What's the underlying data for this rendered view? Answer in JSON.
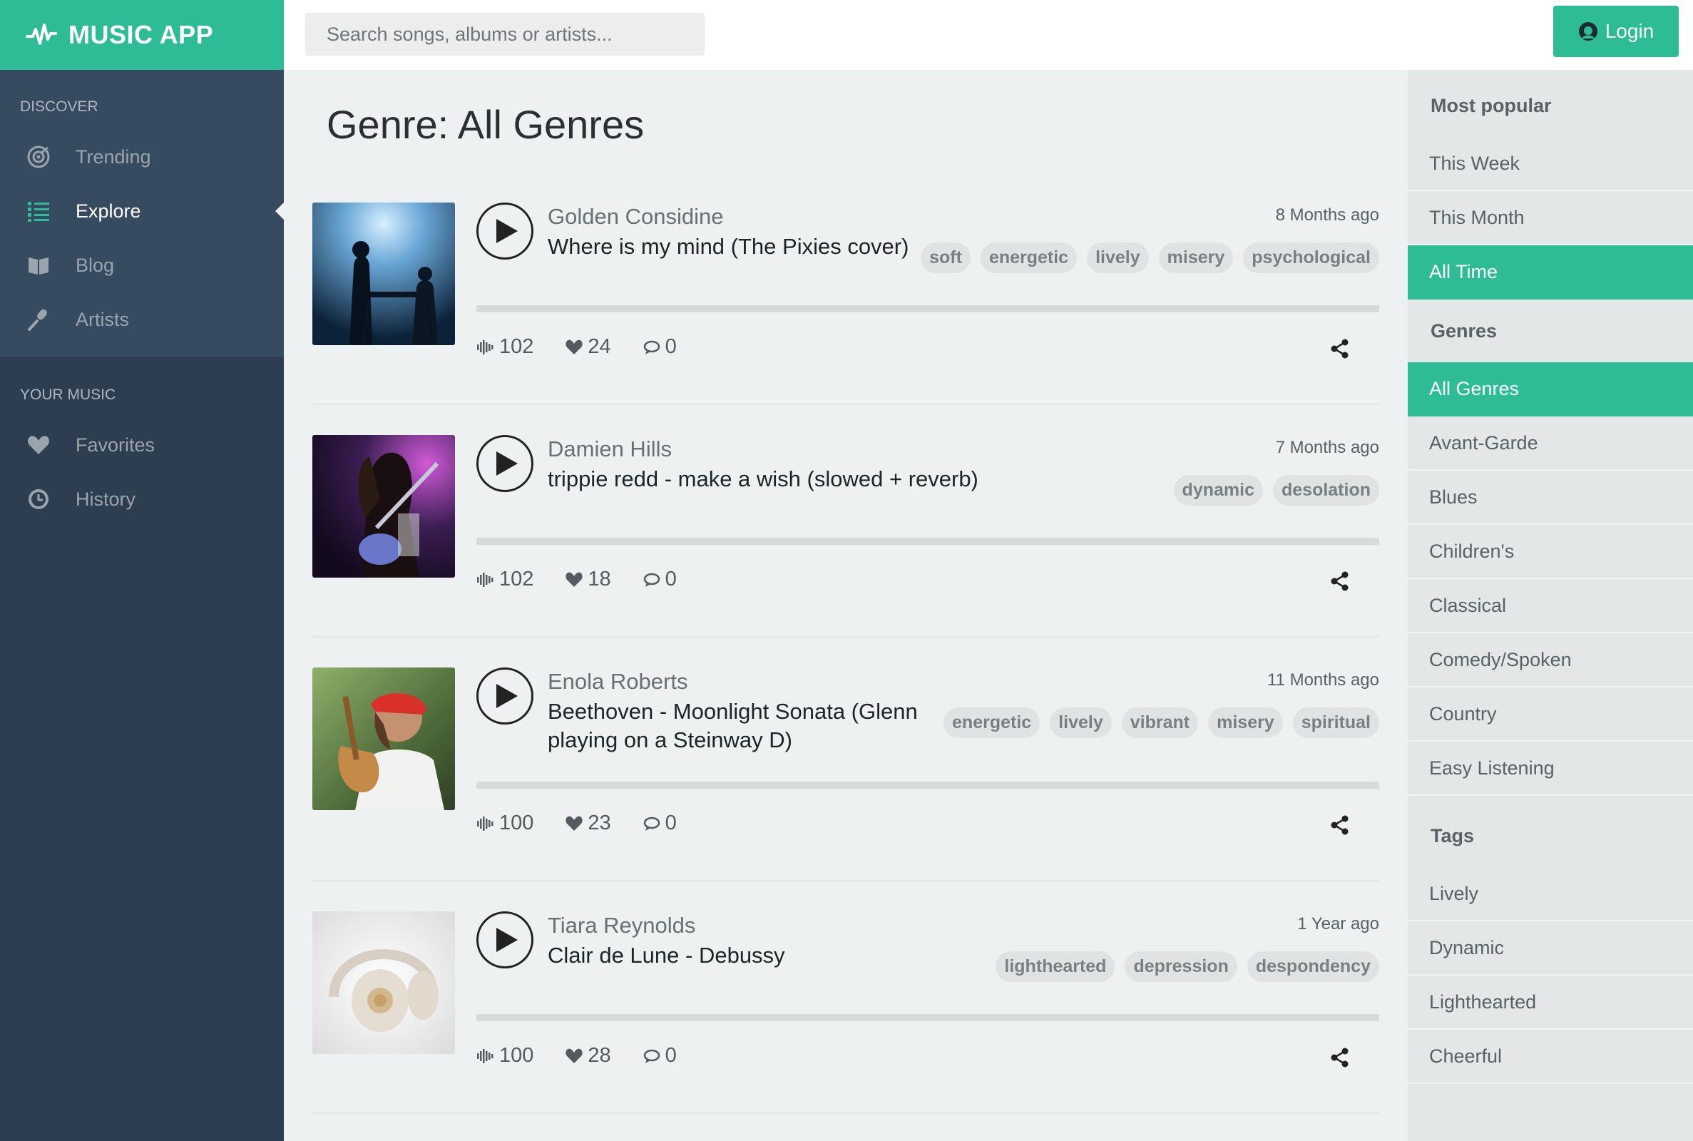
{
  "app": {
    "title": "MUSIC APP"
  },
  "search": {
    "placeholder": "Search songs, albums or artists..."
  },
  "login": {
    "label": "Login"
  },
  "sidebar": {
    "discover_label": "DISCOVER",
    "discover_items": [
      {
        "label": "Trending",
        "icon": "trending-icon"
      },
      {
        "label": "Explore",
        "icon": "list-icon",
        "active": true
      },
      {
        "label": "Blog",
        "icon": "book-icon"
      },
      {
        "label": "Artists",
        "icon": "microphone-icon"
      }
    ],
    "your_music_label": "YOUR MUSIC",
    "your_items": [
      {
        "label": "Favorites",
        "icon": "heart-icon"
      },
      {
        "label": "History",
        "icon": "clock-icon"
      }
    ]
  },
  "main": {
    "title": "Genre: All Genres",
    "tracks": [
      {
        "artist": "Golden Considine",
        "song": "Where is my mind (The Pixies cover)",
        "ago": "8 Months ago",
        "tags": [
          "soft",
          "energetic",
          "lively",
          "misery",
          "psychological"
        ],
        "plays": "102",
        "likes": "24",
        "comments": "0"
      },
      {
        "artist": "Damien Hills",
        "song": "trippie redd - make a wish (slowed + reverb)",
        "ago": "7 Months ago",
        "tags": [
          "dynamic",
          "desolation"
        ],
        "plays": "102",
        "likes": "18",
        "comments": "0"
      },
      {
        "artist": "Enola Roberts",
        "song": "Beethoven - Moonlight Sonata (Glenn playing on a Steinway D)",
        "ago": "11 Months ago",
        "tags": [
          "energetic",
          "lively",
          "vibrant",
          "misery",
          "spiritual"
        ],
        "plays": "100",
        "likes": "23",
        "comments": "0"
      },
      {
        "artist": "Tiara Reynolds",
        "song": "Clair de Lune - Debussy",
        "ago": "1 Year ago",
        "tags": [
          "lighthearted",
          "depression",
          "despondency"
        ],
        "plays": "100",
        "likes": "28",
        "comments": "0"
      }
    ]
  },
  "right_sidebar": {
    "popular_label": "Most popular",
    "popular_items": [
      "This Week",
      "This Month",
      "All Time"
    ],
    "popular_selected": "All Time",
    "genres_label": "Genres",
    "genre_items": [
      "All Genres",
      "Avant-Garde",
      "Blues",
      "Children's",
      "Classical",
      "Comedy/Spoken",
      "Country",
      "Easy Listening"
    ],
    "genre_selected": "All Genres",
    "tags_label": "Tags",
    "tag_items": [
      "Lively",
      "Dynamic",
      "Lighthearted",
      "Cheerful"
    ]
  },
  "colors": {
    "accent": "#2dbc96",
    "sidebar_dark": "#2d3e50",
    "sidebar_light": "#364b5f"
  }
}
